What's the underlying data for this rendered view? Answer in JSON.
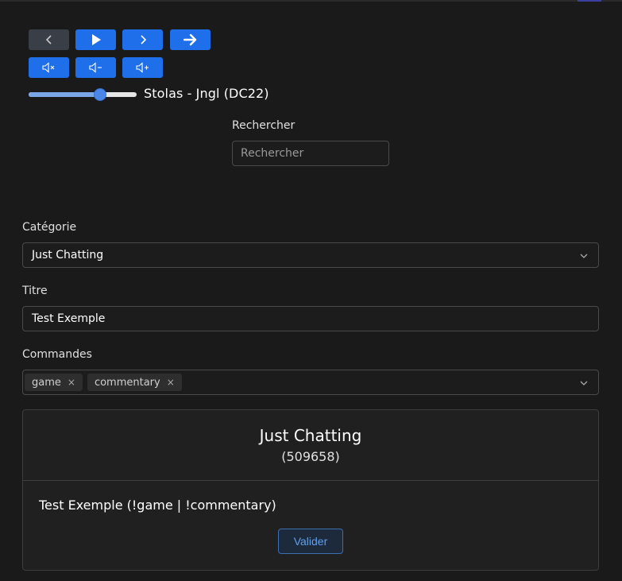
{
  "player": {
    "buttons": {
      "previous_icon": "chevron-left-icon",
      "play_icon": "play-icon",
      "next_icon": "chevron-right-icon",
      "skip_icon": "arrow-right-icon",
      "mute_icon": "volume-mute-icon",
      "volume_down_icon": "volume-down-icon",
      "volume_up_icon": "volume-up-icon"
    },
    "volume_level": 0.66,
    "now_playing": "Stolas - Jngl (DC22)"
  },
  "search": {
    "label": "Rechercher",
    "placeholder": "Rechercher",
    "value": ""
  },
  "form": {
    "category": {
      "label": "Catégorie",
      "value": "Just Chatting"
    },
    "title": {
      "label": "Titre",
      "value": "Test Exemple"
    },
    "commands": {
      "label": "Commandes",
      "chips": [
        "game",
        "commentary"
      ],
      "remove_glyph": "×"
    }
  },
  "preview": {
    "category_name": "Just Chatting",
    "category_id": "(509658)",
    "summary": "Test Exemple (!game | !commentary)",
    "validate_label": "Valider"
  },
  "colors": {
    "primary": "#1f6feb",
    "disabled": "#3a3f47",
    "background": "#1a1a1a",
    "outline_accent": "#5ea0f2"
  }
}
